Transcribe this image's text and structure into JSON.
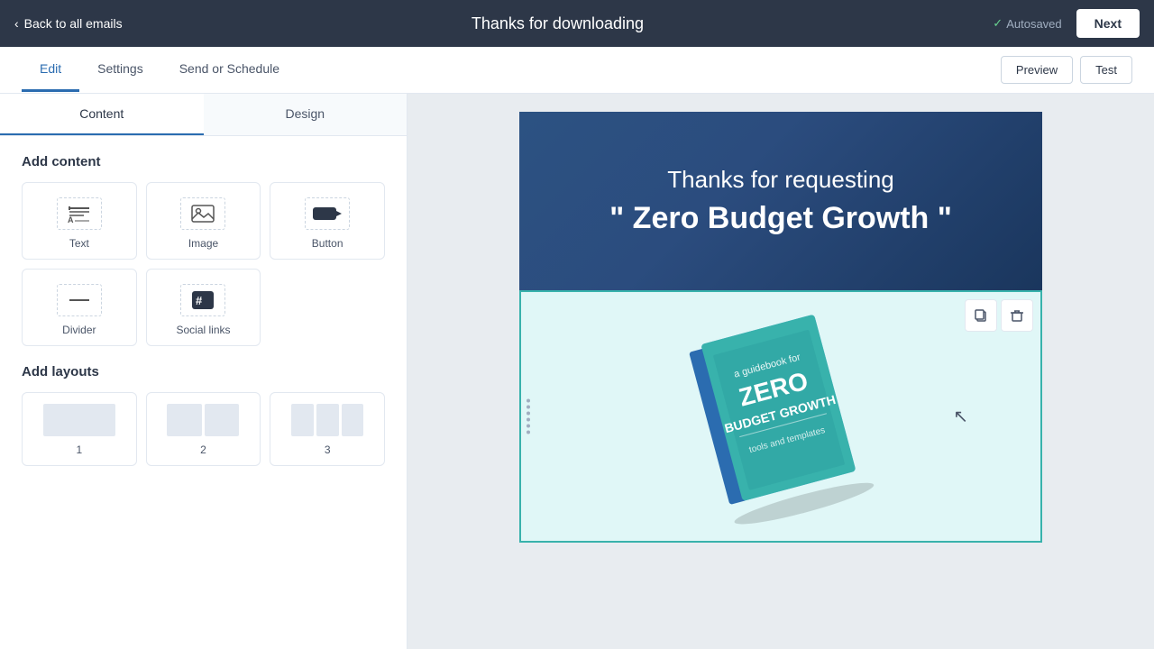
{
  "topbar": {
    "back_label": "Back to all emails",
    "title": "Thanks for downloading",
    "autosaved_label": "Autosaved",
    "next_label": "Next"
  },
  "subnav": {
    "tabs": [
      {
        "id": "edit",
        "label": "Edit",
        "active": true
      },
      {
        "id": "settings",
        "label": "Settings",
        "active": false
      },
      {
        "id": "send-schedule",
        "label": "Send or Schedule",
        "active": false
      }
    ],
    "preview_label": "Preview",
    "test_label": "Test"
  },
  "left_panel": {
    "tabs": [
      {
        "id": "content",
        "label": "Content",
        "active": true
      },
      {
        "id": "design",
        "label": "Design",
        "active": false
      }
    ],
    "add_content_title": "Add content",
    "content_items": [
      {
        "id": "text",
        "label": "Text",
        "icon": "text-icon"
      },
      {
        "id": "image",
        "label": "Image",
        "icon": "image-icon"
      },
      {
        "id": "button",
        "label": "Button",
        "icon": "button-icon"
      },
      {
        "id": "divider",
        "label": "Divider",
        "icon": "divider-icon"
      },
      {
        "id": "social",
        "label": "Social links",
        "icon": "social-icon"
      }
    ],
    "add_layouts_title": "Add layouts",
    "layout_items": [
      {
        "id": "1col",
        "label": "1",
        "cols": 1
      },
      {
        "id": "2col",
        "label": "2",
        "cols": 2
      },
      {
        "id": "3col",
        "label": "3",
        "cols": 3
      }
    ]
  },
  "email": {
    "header_line1": "Thanks for requesting",
    "header_line2": "\" Zero Budget Growth \"",
    "book_title_line1": "a guidebook for",
    "book_title_main": "ZERO",
    "book_title_sub": "BUDGET GROWTH",
    "book_tagline": "tools and templates"
  },
  "actions": {
    "copy_icon": "copy-icon",
    "delete_icon": "delete-icon"
  }
}
